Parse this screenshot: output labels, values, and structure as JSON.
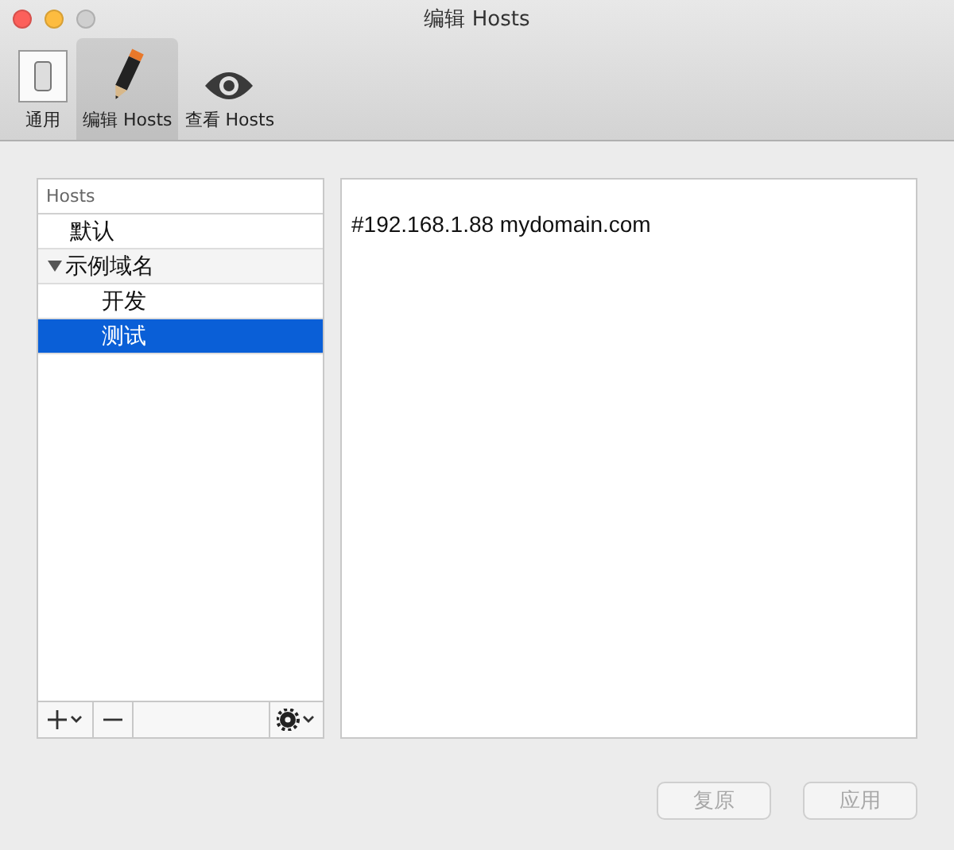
{
  "window": {
    "title": "编辑 Hosts"
  },
  "toolbar": [
    {
      "label": "通用",
      "selected": false
    },
    {
      "label": "编辑 Hosts",
      "selected": true
    },
    {
      "label": "查看 Hosts",
      "selected": false
    }
  ],
  "sidebar": {
    "header": "Hosts",
    "items": [
      {
        "label": "默认",
        "selected": false
      },
      {
        "label": "示例域名",
        "selected": false,
        "expanded": true,
        "children": [
          {
            "label": "开发",
            "selected": false
          },
          {
            "label": "测试",
            "selected": true
          }
        ]
      }
    ]
  },
  "editor": {
    "value": "#192.168.1.88 mydomain.com"
  },
  "buttons": [
    {
      "label": "复原",
      "disabled": true
    },
    {
      "label": "应用",
      "disabled": true
    }
  ]
}
